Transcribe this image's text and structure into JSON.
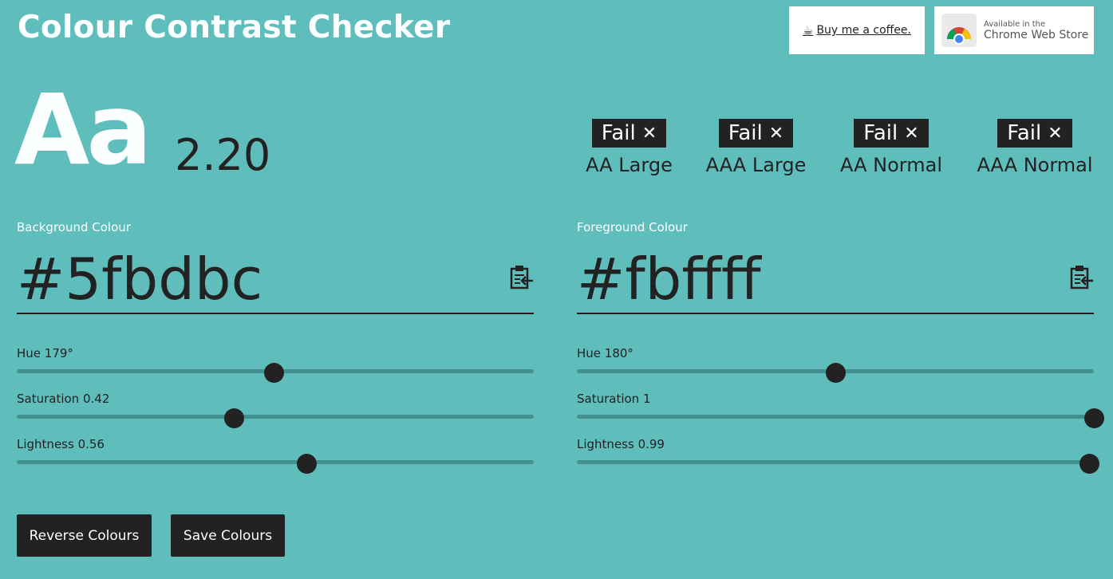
{
  "header": {
    "title": "Colour Contrast Checker",
    "coffee_label": "Buy me a coffee.",
    "chrome_small": "Available in the",
    "chrome_big": "Chrome Web Store"
  },
  "preview": {
    "sample_text": "Aa",
    "ratio": "2.20"
  },
  "badges": [
    {
      "status": "Fail",
      "mark": "✕",
      "label": "AA Large"
    },
    {
      "status": "Fail",
      "mark": "✕",
      "label": "AAA Large"
    },
    {
      "status": "Fail",
      "mark": "✕",
      "label": "AA Normal"
    },
    {
      "status": "Fail",
      "mark": "✕",
      "label": "AAA Normal"
    }
  ],
  "background": {
    "label": "Background Colour",
    "hex": "#5fbdbc",
    "hue_label": "Hue 179°",
    "hue_value": 179,
    "hue_max": 360,
    "saturation_label": "Saturation 0.42",
    "saturation_value": 0.42,
    "lightness_label": "Lightness 0.56",
    "lightness_value": 0.56
  },
  "foreground": {
    "label": "Foreground Colour",
    "hex": "#fbffff",
    "hue_label": "Hue 180°",
    "hue_value": 180,
    "hue_max": 360,
    "saturation_label": "Saturation 1",
    "saturation_value": 1,
    "lightness_label": "Lightness 0.99",
    "lightness_value": 0.99
  },
  "actions": {
    "reverse_label": "Reverse Colours",
    "save_label": "Save Colours"
  },
  "colors": {
    "background": "#5fbdbc",
    "foreground": "#fbffff",
    "dark": "#222222",
    "track": "#43908f"
  },
  "icons": {
    "paste": "clipboard-paste-icon",
    "coffee": "coffee-cup-icon",
    "chrome": "chrome-logo-icon",
    "close": "close-icon"
  }
}
